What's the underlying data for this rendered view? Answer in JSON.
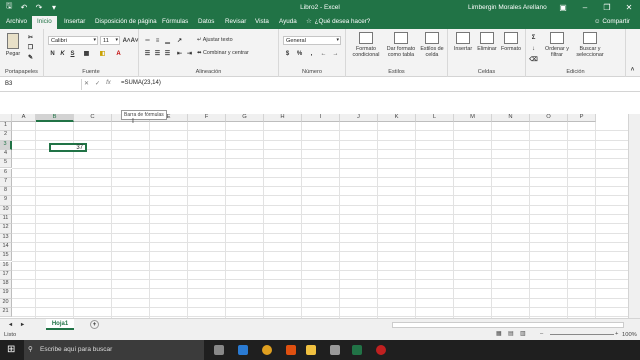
{
  "window": {
    "title": "Libro2  -  Excel",
    "user": "Limbergin Morales Arellano"
  },
  "tabs": [
    "Archivo",
    "Inicio",
    "Insertar",
    "Disposición de página",
    "Fórmulas",
    "Datos",
    "Revisar",
    "Vista",
    "Ayuda"
  ],
  "tellme": "¿Qué desea hacer?",
  "share": "Compartir",
  "ribbon": {
    "clipboard": {
      "paste": "Pegar",
      "label": "Portapapeles"
    },
    "font": {
      "name": "Calibri",
      "size": "11",
      "label": "Fuente",
      "bold": "N",
      "italic": "K",
      "underline": "S"
    },
    "alignment": {
      "wrap": "Ajustar texto",
      "merge": "Combinar y centrar",
      "label": "Alineación"
    },
    "number": {
      "format": "General",
      "label": "Número"
    },
    "styles": {
      "conditional": "Formato condicional",
      "table": "Dar formato como tabla",
      "cell": "Estilos de celda",
      "label": "Estilos"
    },
    "cells": {
      "insert": "Insertar",
      "delete": "Eliminar",
      "format": "Formato",
      "label": "Celdas"
    },
    "editing": {
      "sort": "Ordenar y filtrar",
      "find": "Buscar y seleccionar",
      "label": "Edición"
    }
  },
  "formula_bar": {
    "name_box": "B3",
    "formula": "=SUMA(23,14)",
    "tooltip": "Barra de fórmulas"
  },
  "grid": {
    "columns": [
      "A",
      "B",
      "C",
      "D",
      "E",
      "F",
      "G",
      "H",
      "I",
      "J",
      "K",
      "L",
      "M",
      "N",
      "O",
      "P"
    ],
    "rows": [
      "1",
      "2",
      "3",
      "4",
      "5",
      "6",
      "7",
      "8",
      "9",
      "10",
      "11",
      "12",
      "13",
      "14",
      "15",
      "16",
      "17",
      "18",
      "19",
      "20",
      "21"
    ],
    "selected_cell_value": "37"
  },
  "sheet": {
    "tab": "Hoja1",
    "add": "+"
  },
  "status": {
    "ready": "Listo",
    "zoom": "100%"
  },
  "taskbar": {
    "search": "Escribe aquí para buscar"
  }
}
